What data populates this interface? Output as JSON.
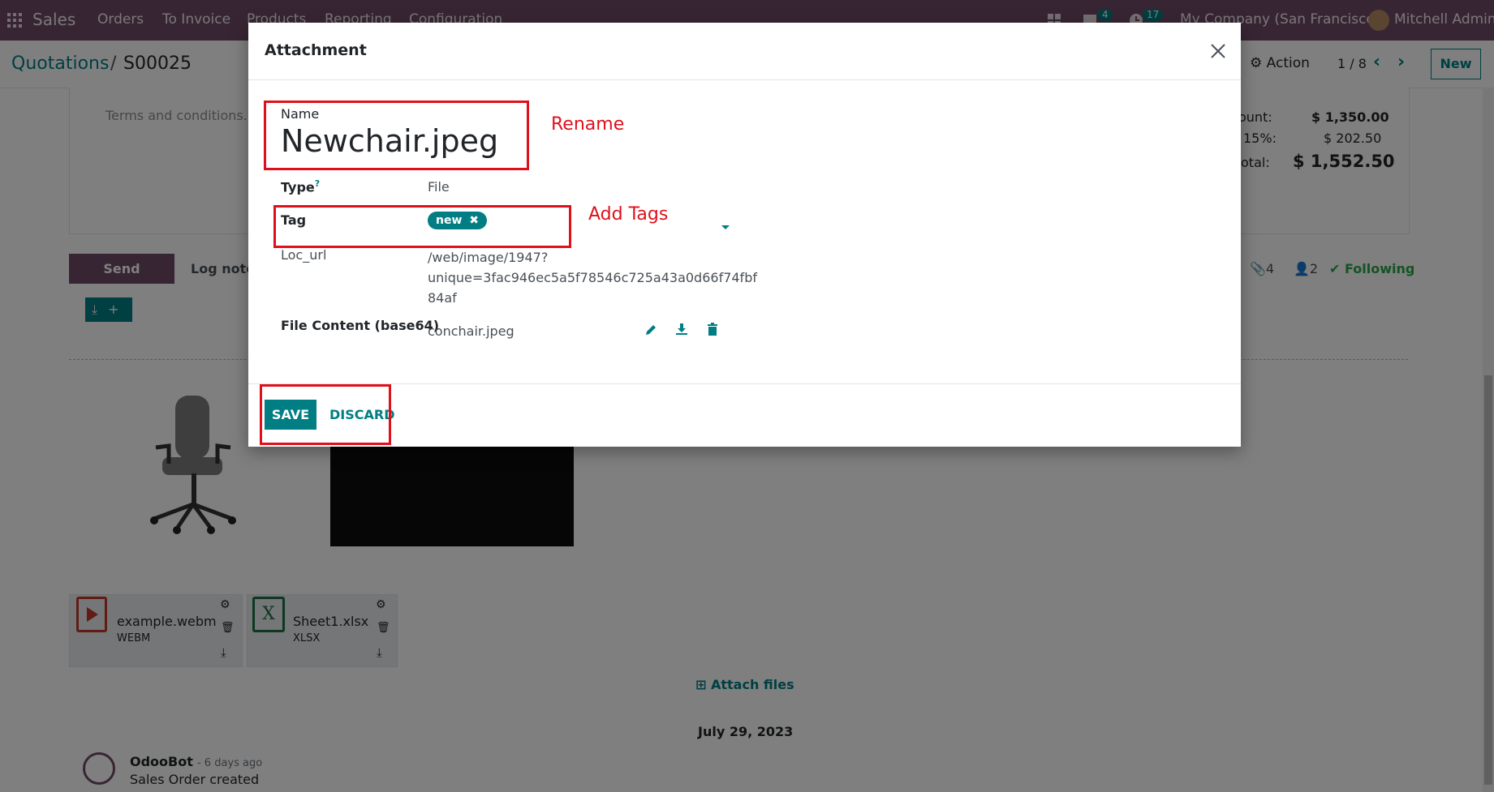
{
  "navbar": {
    "app_name": "Sales",
    "menu": [
      "Orders",
      "To Invoice",
      "Products",
      "Reporting",
      "Configuration"
    ],
    "messages_count": "4",
    "activities_count": "17",
    "company": "My Company (San Francisco)",
    "user": "Mitchell Admin"
  },
  "breadcrumb": {
    "parent": "Quotations",
    "separator": "/",
    "current": "S00025"
  },
  "control": {
    "action_label": "Action",
    "pager": "1 / 8",
    "new_label": "New"
  },
  "form": {
    "terms_placeholder": "Terms and conditions...",
    "totals": [
      {
        "label": "ount:",
        "value": "$ 1,350.00"
      },
      {
        "label": "15%:",
        "value": "$ 202.50"
      },
      {
        "label": "otal:",
        "value": "$ 1,552.50"
      }
    ]
  },
  "chatter": {
    "send_message": "Send message",
    "log_note": "Log note",
    "attachments_count": "4",
    "followers_count": "2",
    "following_label": "Following",
    "attachments": [
      {
        "name": "example.webm",
        "type": "WEBM"
      },
      {
        "name": "Sheet1.xlsx",
        "type": "XLSX"
      }
    ],
    "attach_files": "Attach files",
    "date_separator": "July 29, 2023",
    "message": {
      "author": "OdooBot",
      "time": "- 6 days ago",
      "body": "Sales Order created"
    }
  },
  "dialog": {
    "title": "Attachment",
    "name_label": "Name",
    "name_value": "Newchair.jpeg",
    "type_label": "Type",
    "type_help": "?",
    "type_value": "File",
    "tag_label": "Tag",
    "tag_value": "new",
    "loc_url_label": "Loc_url",
    "loc_url_lines": [
      "/web/image/1947?",
      "unique=3fac946ec5a5f78546c725a43a0d66f74fbf",
      "84af"
    ],
    "file_content_label": "File Content (base64)",
    "file_content_value": "conchair.jpeg",
    "save_label": "SAVE",
    "discard_label": "DISCARD"
  },
  "annotations": {
    "rename": "Rename",
    "add_tags": "Add Tags"
  },
  "colors": {
    "brand_purple": "#714B67",
    "teal": "#017e84",
    "annotation_red": "#e0101a"
  }
}
